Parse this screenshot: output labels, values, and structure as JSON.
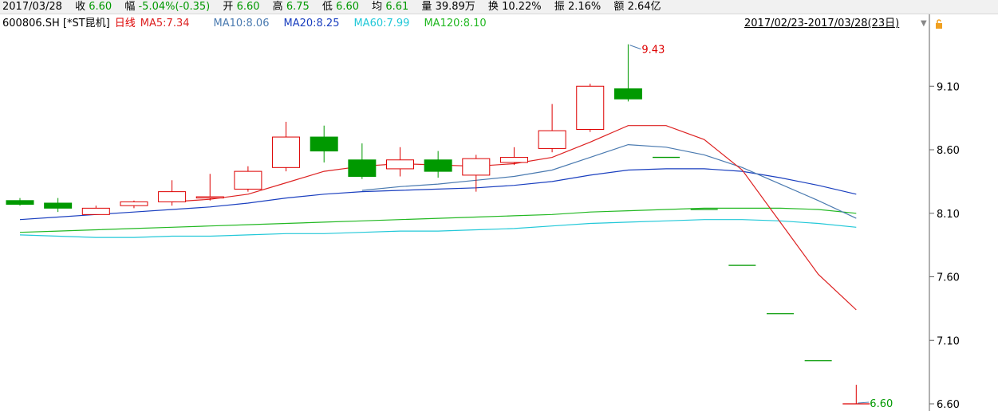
{
  "info": {
    "date": "2017/03/28",
    "close_label": "收",
    "close": "6.60",
    "change_label": "幅",
    "change": "-5.04%(-0.35)",
    "open_label": "开",
    "open": "6.60",
    "high_label": "高",
    "high": "6.75",
    "low_label": "低",
    "low": "6.60",
    "avg_label": "均",
    "avg": "6.61",
    "volume_label": "量",
    "volume": "39.89万",
    "turnover_label": "换",
    "turnover": "10.22%",
    "amplitude_label": "振",
    "amplitude": "2.16%",
    "amount_label": "额",
    "amount": "2.64亿"
  },
  "legend": {
    "symbol": "600806.SH [*ST昆机]",
    "period": "日线",
    "ma5": "MA5:7.34",
    "ma10": "MA10:8.06",
    "ma20": "MA20:8.25",
    "ma60": "MA60:7.99",
    "ma120": "MA120:8.10",
    "date_range": "2017/02/23-2017/03/28(23日)"
  },
  "colors": {
    "up": "#dd0000",
    "down": "#009900",
    "ma5": "#dd2222",
    "ma10": "#4a7ab0",
    "ma20": "#1a3fbf",
    "ma60": "#22c8d8",
    "ma120": "#22b822"
  },
  "chart_data": {
    "type": "candlestick",
    "ylim": [
      6.6,
      9.5
    ],
    "yticks": [
      "9.10",
      "8.60",
      "8.10",
      "7.60",
      "7.10",
      "6.60"
    ],
    "annotations": {
      "high_label": "9.43",
      "low_label": "6.60"
    },
    "candles": [
      {
        "o": 8.2,
        "h": 8.22,
        "l": 8.16,
        "c": 8.17
      },
      {
        "o": 8.18,
        "h": 8.22,
        "l": 8.11,
        "c": 8.14
      },
      {
        "o": 8.09,
        "h": 8.16,
        "l": 8.09,
        "c": 8.14
      },
      {
        "o": 8.16,
        "h": 8.2,
        "l": 8.14,
        "c": 8.19
      },
      {
        "o": 8.19,
        "h": 8.36,
        "l": 8.16,
        "c": 8.27
      },
      {
        "o": 8.22,
        "h": 8.41,
        "l": 8.2,
        "c": 8.23
      },
      {
        "o": 8.29,
        "h": 8.47,
        "l": 8.27,
        "c": 8.43
      },
      {
        "o": 8.46,
        "h": 8.82,
        "l": 8.43,
        "c": 8.7
      },
      {
        "o": 8.7,
        "h": 8.79,
        "l": 8.5,
        "c": 8.59
      },
      {
        "o": 8.52,
        "h": 8.65,
        "l": 8.37,
        "c": 8.39
      },
      {
        "o": 8.45,
        "h": 8.62,
        "l": 8.39,
        "c": 8.52
      },
      {
        "o": 8.52,
        "h": 8.59,
        "l": 8.38,
        "c": 8.43
      },
      {
        "o": 8.4,
        "h": 8.56,
        "l": 8.27,
        "c": 8.53
      },
      {
        "o": 8.5,
        "h": 8.62,
        "l": 8.48,
        "c": 8.54
      },
      {
        "o": 8.61,
        "h": 8.96,
        "l": 8.58,
        "c": 8.75
      },
      {
        "o": 8.76,
        "h": 9.12,
        "l": 8.74,
        "c": 9.1
      },
      {
        "o": 9.08,
        "h": 9.43,
        "l": 8.98,
        "c": 9.0
      },
      {
        "o": 8.54,
        "h": 8.54,
        "l": 8.54,
        "c": 8.54
      },
      {
        "o": 8.13,
        "h": 8.13,
        "l": 8.13,
        "c": 8.13
      },
      {
        "o": 7.69,
        "h": 7.69,
        "l": 7.69,
        "c": 7.69
      },
      {
        "o": 7.31,
        "h": 7.31,
        "l": 7.31,
        "c": 7.31
      },
      {
        "o": 6.94,
        "h": 6.94,
        "l": 6.94,
        "c": 6.94
      },
      {
        "o": 6.6,
        "h": 6.75,
        "l": 6.6,
        "c": 6.6
      }
    ],
    "ma5": [
      null,
      null,
      null,
      null,
      8.19,
      8.21,
      8.25,
      8.34,
      8.43,
      8.47,
      8.49,
      8.48,
      8.47,
      8.49,
      8.54,
      8.66,
      8.79,
      8.79,
      8.68,
      8.44,
      8.03,
      7.62,
      7.34
    ],
    "ma10": [
      null,
      null,
      null,
      null,
      null,
      null,
      null,
      null,
      null,
      8.28,
      8.31,
      8.33,
      8.36,
      8.39,
      8.44,
      8.54,
      8.64,
      8.62,
      8.56,
      8.46,
      8.33,
      8.2,
      8.06
    ],
    "ma20": [
      8.05,
      8.07,
      8.09,
      8.11,
      8.13,
      8.15,
      8.18,
      8.22,
      8.25,
      8.27,
      8.28,
      8.29,
      8.3,
      8.32,
      8.35,
      8.4,
      8.44,
      8.45,
      8.45,
      8.43,
      8.38,
      8.32,
      8.25
    ],
    "ma60": [
      7.93,
      7.92,
      7.91,
      7.91,
      7.92,
      7.92,
      7.93,
      7.94,
      7.94,
      7.95,
      7.96,
      7.96,
      7.97,
      7.98,
      8.0,
      8.02,
      8.03,
      8.04,
      8.05,
      8.05,
      8.04,
      8.02,
      7.99
    ],
    "ma120": [
      7.95,
      7.96,
      7.97,
      7.98,
      7.99,
      8.0,
      8.01,
      8.02,
      8.03,
      8.04,
      8.05,
      8.06,
      8.07,
      8.08,
      8.09,
      8.11,
      8.12,
      8.13,
      8.14,
      8.14,
      8.14,
      8.13,
      8.1
    ]
  }
}
